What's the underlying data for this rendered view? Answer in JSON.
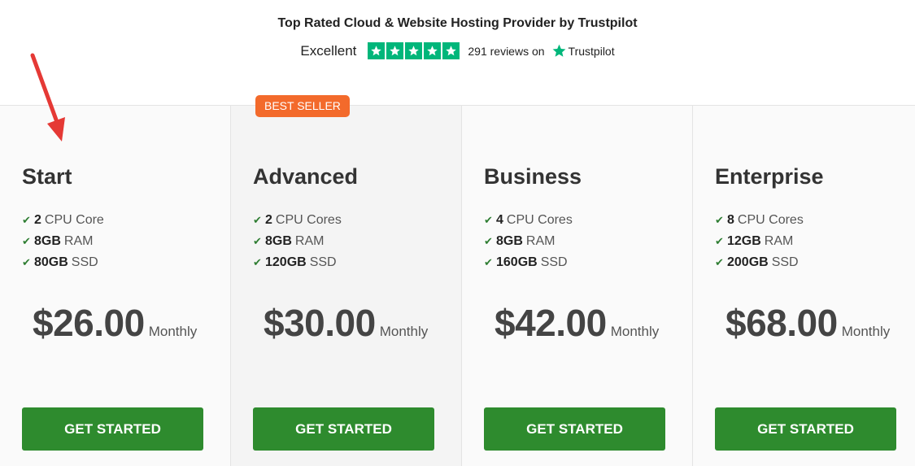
{
  "trust": {
    "title": "Top Rated Cloud & Website Hosting Provider by Trustpilot",
    "rating_word": "Excellent",
    "stars": 5,
    "reviews_text": "291 reviews on",
    "brand": "Trustpilot",
    "star_color": "#00b67a"
  },
  "plans": [
    {
      "name": "Start",
      "features": [
        {
          "value": "2",
          "label": "CPU Core"
        },
        {
          "value": "8GB",
          "label": "RAM"
        },
        {
          "value": "80GB",
          "label": "SSD"
        }
      ],
      "price": "$26.00",
      "period": "Monthly",
      "cta": "GET STARTED"
    },
    {
      "name": "Advanced",
      "badge": "BEST SELLER",
      "features": [
        {
          "value": "2",
          "label": "CPU Cores"
        },
        {
          "value": "8GB",
          "label": "RAM"
        },
        {
          "value": "120GB",
          "label": "SSD"
        }
      ],
      "price": "$30.00",
      "period": "Monthly",
      "cta": "GET STARTED"
    },
    {
      "name": "Business",
      "features": [
        {
          "value": "4",
          "label": "CPU Cores"
        },
        {
          "value": "8GB",
          "label": "RAM"
        },
        {
          "value": "160GB",
          "label": "SSD"
        }
      ],
      "price": "$42.00",
      "period": "Monthly",
      "cta": "GET STARTED"
    },
    {
      "name": "Enterprise",
      "features": [
        {
          "value": "8",
          "label": "CPU Cores"
        },
        {
          "value": "12GB",
          "label": "RAM"
        },
        {
          "value": "200GB",
          "label": "SSD"
        }
      ],
      "price": "$68.00",
      "period": "Monthly",
      "cta": "GET STARTED"
    }
  ],
  "colors": {
    "cta": "#2e8b2e",
    "badge": "#f36a2b",
    "check": "#2e7d32",
    "annotation_arrow": "#e53935"
  }
}
